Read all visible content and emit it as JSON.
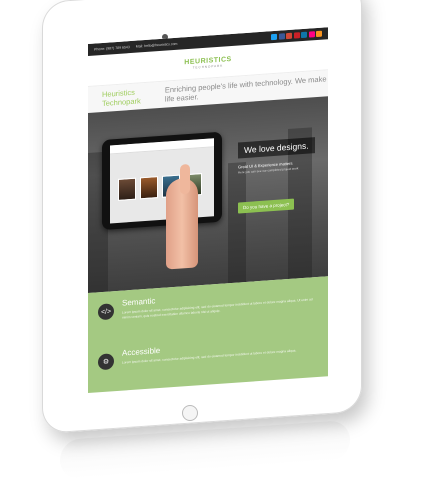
{
  "topbar": {
    "phone": "Phone: (987) 789 6543",
    "email": "Mail: hello@heuristics.com"
  },
  "social_icons": [
    {
      "name": "twitter-icon",
      "color": "#1da1f2"
    },
    {
      "name": "facebook-icon",
      "color": "#3b5998"
    },
    {
      "name": "google-plus-icon",
      "color": "#d34836"
    },
    {
      "name": "pinterest-icon",
      "color": "#cb2027"
    },
    {
      "name": "linkedin-icon",
      "color": "#0e76a8"
    },
    {
      "name": "flickr-icon",
      "color": "#ff0084"
    },
    {
      "name": "rss-icon",
      "color": "#f7931e"
    }
  ],
  "logo": {
    "name": "HEURISTICS",
    "sub": "TECHNOPARK"
  },
  "tagline": {
    "brand": "Heuristics Technopark",
    "text": "Enriching people's life with technology. We make life easier."
  },
  "hero": {
    "title": "We love designs.",
    "subtitle": "Great UI & Experience matters",
    "subtext": "Here you can see our completed project work",
    "cta": "Do you have a project?"
  },
  "features": [
    {
      "icon": "code-icon",
      "title": "Semantic",
      "desc": "Lorem ipsum dolor sit amet, consectetur adipisicing elit, sed do eiusmod tempor incididunt ut labore et dolore magna aliqua. Ut enim ad minim veniam, quis nostrud exercitation ullamco laboris nisi ut aliquip."
    },
    {
      "icon": "gear-icon",
      "title": "Accessible",
      "desc": "Lorem ipsum dolor sit amet, consectetur adipisicing elit, sed do eiusmod tempor incididunt ut labore et dolore magna aliqua."
    }
  ],
  "colors": {
    "accent": "#8cc051",
    "feature_bg": "#a4c982",
    "topbar_bg": "#262626"
  }
}
